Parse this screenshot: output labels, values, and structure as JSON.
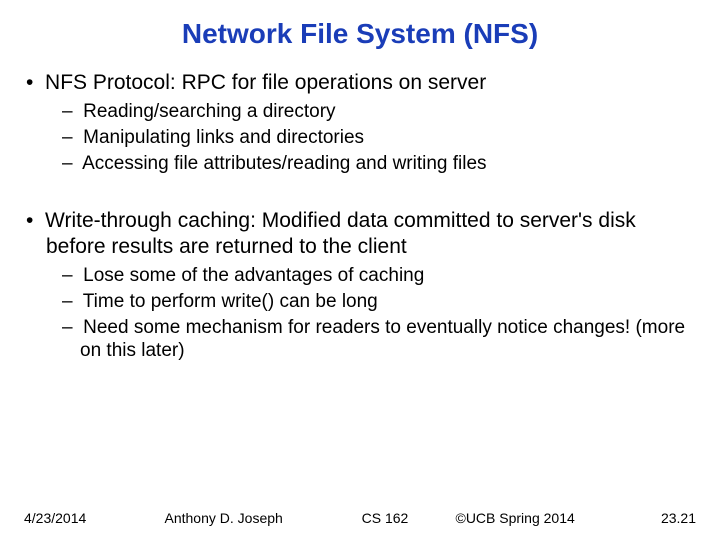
{
  "title": "Network File System (NFS)",
  "bullets": {
    "b1": "NFS Protocol: RPC for file operations on server",
    "b1_1": "Reading/searching a directory",
    "b1_2": "Manipulating links and directories",
    "b1_3": "Accessing file attributes/reading and writing files",
    "b2": "Write-through caching: Modified data committed to server's disk before results are returned to the client",
    "b2_1": "Lose some of the advantages of caching",
    "b2_2": "Time to perform write() can be long",
    "b2_3": "Need some mechanism for readers to eventually notice changes! (more on this later)"
  },
  "footer": {
    "date": "4/23/2014",
    "author": "Anthony D. Joseph",
    "course": "CS 162",
    "copyright": "©UCB Spring 2014",
    "page": "23.21"
  }
}
